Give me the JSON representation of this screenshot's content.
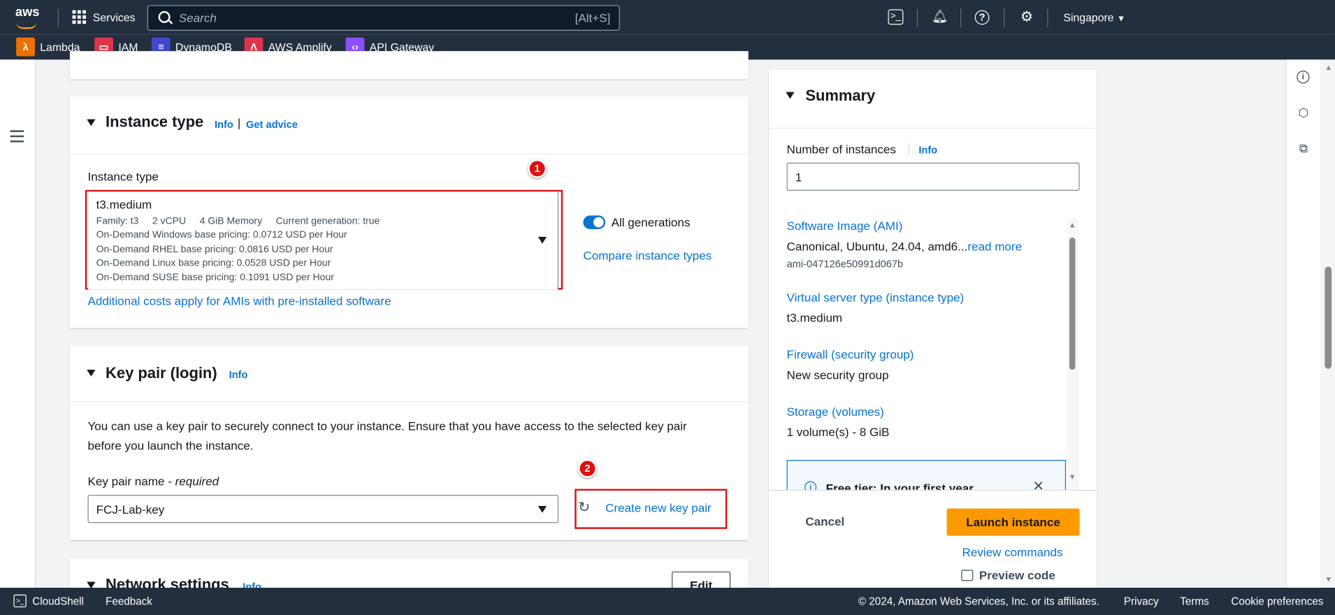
{
  "topbar": {
    "logo": "aws",
    "services_label": "Services",
    "search_placeholder": "Search",
    "search_shortcut": "[Alt+S]",
    "region": "Singapore",
    "favorites": [
      {
        "label": "Lambda",
        "color": "#ed7100",
        "icon": "lambda-icon"
      },
      {
        "label": "IAM",
        "color": "#dd344c",
        "icon": "iam-icon"
      },
      {
        "label": "DynamoDB",
        "color": "#3f48cc",
        "icon": "dynamodb-icon"
      },
      {
        "label": "AWS Amplify",
        "color": "#dd344c",
        "icon": "amplify-icon"
      },
      {
        "label": "API Gateway",
        "color": "#8c4fff",
        "icon": "api-gateway-icon"
      }
    ]
  },
  "instance_type": {
    "title": "Instance type",
    "info": "Info",
    "separator": "|",
    "get_advice": "Get advice",
    "field_label": "Instance type",
    "selected": "t3.medium",
    "details": {
      "family": "Family: t3",
      "vcpu": "2 vCPU",
      "memory": "4 GiB Memory",
      "generation": "Current generation: true"
    },
    "pricing": [
      "On-Demand Windows base pricing: 0.0712 USD per Hour",
      "On-Demand RHEL base pricing: 0.0816 USD per Hour",
      "On-Demand Linux base pricing: 0.0528 USD per Hour",
      "On-Demand SUSE base pricing: 0.1091 USD per Hour"
    ],
    "all_generations_label": "All generations",
    "all_generations_on": true,
    "compare_link": "Compare instance types",
    "additional_costs_link": "Additional costs apply for AMIs with pre-installed software",
    "annotation": "1"
  },
  "key_pair": {
    "title": "Key pair (login)",
    "info": "Info",
    "description": "You can use a key pair to securely connect to your instance. Ensure that you have access to the selected key pair before you launch the instance.",
    "field_label": "Key pair name",
    "field_required": " - required",
    "selected": "FCJ-Lab-key",
    "create_link": "Create new key pair",
    "annotation": "2"
  },
  "network": {
    "title": "Network settings",
    "info": "Info",
    "edit": "Edit"
  },
  "summary": {
    "title": "Summary",
    "num_instances_label": "Number of instances",
    "info": "Info",
    "num_instances_value": "1",
    "items": [
      {
        "key": "Software Image (AMI)",
        "value": "Canonical, Ubuntu, 24.04, amd6...",
        "more": "read more",
        "sub": "ami-047126e50991d067b"
      },
      {
        "key": "Virtual server type (instance type)",
        "value": "t3.medium"
      },
      {
        "key": "Firewall (security group)",
        "value": "New security group"
      },
      {
        "key": "Storage (volumes)",
        "value": "1 volume(s) - 8 GiB"
      }
    ],
    "free_tier_text": "Free tier: In your first year",
    "cancel": "Cancel",
    "launch": "Launch instance",
    "review": "Review commands",
    "preview": "Preview code",
    "accent": "#ff9900"
  },
  "footer": {
    "cloudshell": "CloudShell",
    "feedback": "Feedback",
    "copyright": "© 2024, Amazon Web Services, Inc. or its affiliates.",
    "privacy": "Privacy",
    "terms": "Terms",
    "cookies": "Cookie preferences"
  }
}
